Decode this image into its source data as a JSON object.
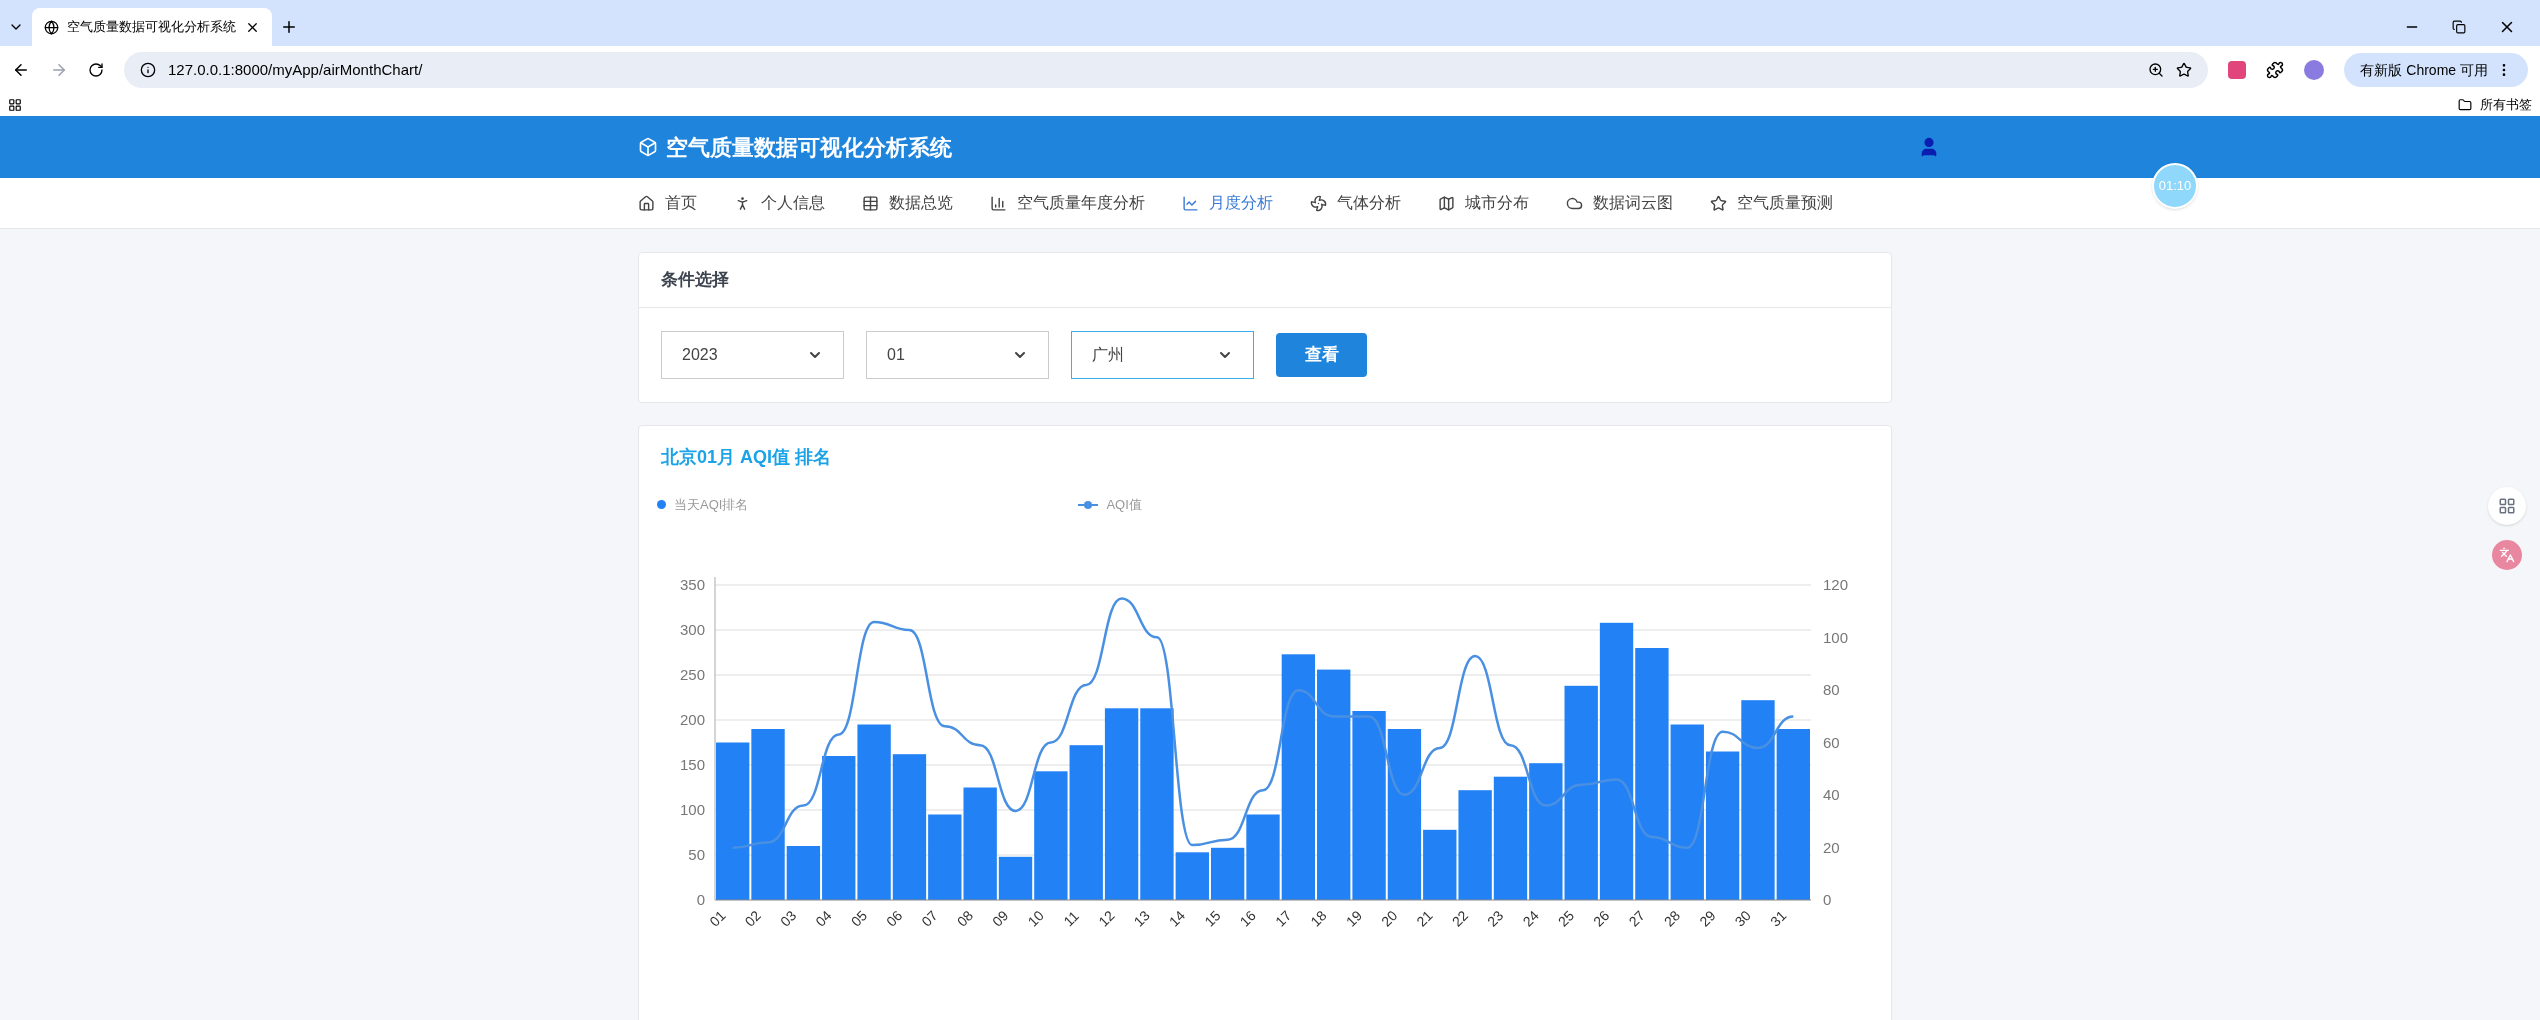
{
  "browser": {
    "tab_title": "空气质量数据可视化分析系统",
    "url": "127.0.0.1:8000/myApp/airMonthChart/",
    "update_button": "有新版 Chrome 可用",
    "bookmarks_label": "所有书签"
  },
  "header": {
    "title": "空气质量数据可视化分析系统"
  },
  "nav": [
    {
      "label": "首页",
      "selected": false
    },
    {
      "label": "个人信息",
      "selected": false
    },
    {
      "label": "数据总览",
      "selected": false
    },
    {
      "label": "空气质量年度分析",
      "selected": false
    },
    {
      "label": "月度分析",
      "selected": true
    },
    {
      "label": "气体分析",
      "selected": false
    },
    {
      "label": "城市分布",
      "selected": false
    },
    {
      "label": "数据词云图",
      "selected": false
    },
    {
      "label": "空气质量预测",
      "selected": false
    }
  ],
  "timer": "01:10",
  "conditions": {
    "title": "条件选择",
    "selects": [
      {
        "value": "2023",
        "focused": false
      },
      {
        "value": "01",
        "focused": false
      },
      {
        "value": "广州",
        "focused": true
      }
    ],
    "button": "查看"
  },
  "chart_card": {
    "title": "北京01月 AQI值 排名",
    "chart_data": {
      "type": "bar",
      "categories": [
        "01",
        "02",
        "03",
        "04",
        "05",
        "06",
        "07",
        "08",
        "09",
        "10",
        "11",
        "12",
        "13",
        "14",
        "15",
        "16",
        "17",
        "18",
        "19",
        "20",
        "21",
        "22",
        "23",
        "24",
        "25",
        "26",
        "27",
        "28",
        "29",
        "30",
        "31"
      ],
      "stacked": false,
      "grid": true,
      "legend": true,
      "series": [
        {
          "name": "当天AQI排名",
          "type": "bar",
          "color": "#2181f5",
          "values": [
            175,
            190,
            60,
            160,
            195,
            162,
            95,
            125,
            48,
            143,
            172,
            213,
            213,
            53,
            58,
            95,
            273,
            256,
            210,
            190,
            78,
            122,
            137,
            152,
            238,
            308,
            280,
            195,
            165,
            222,
            190
          ]
        },
        {
          "name": "AQI值",
          "type": "line",
          "color": "#4a90e2",
          "values": [
            58,
            64,
            105,
            184,
            309,
            300,
            193,
            172,
            99,
            175,
            239,
            335,
            292,
            61,
            67,
            122,
            233,
            204,
            204,
            117,
            169,
            271,
            172,
            105,
            128,
            134,
            70,
            58,
            187,
            169,
            204
          ]
        }
      ],
      "ylim": [
        0,
        350
      ],
      "yticks": [
        0,
        50,
        100,
        150,
        200,
        250,
        300,
        350
      ],
      "y2lim": [
        0,
        120
      ],
      "y2ticks": [
        0,
        20,
        40,
        60,
        80,
        100,
        120
      ]
    }
  }
}
